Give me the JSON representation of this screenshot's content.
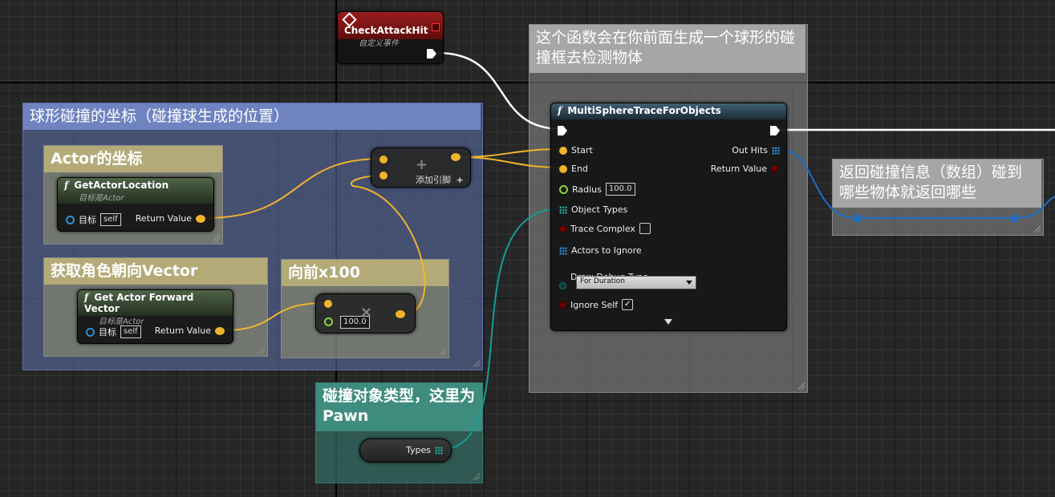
{
  "colors": {
    "exec_wire": "#ffffff",
    "vector_wire": "#f0b42c",
    "array_wire": "#1a6fc9",
    "object_wire": "#149e94"
  },
  "comments": {
    "sphere_position": "球形碰撞的坐标（碰撞球生成的位置）",
    "actor_location": "Actor的坐标",
    "forward_vector": "获取角色朝向Vector",
    "forward_x100": "向前x100",
    "trace_note": "这个函数会在你前面生成一个球形的碰撞框去检测物体",
    "return_note": "返回碰撞信息（数组）碰到哪些物体就返回哪些",
    "object_type_note": "碰撞对象类型，这里为Pawn"
  },
  "event_node": {
    "title": "CheckAttackHit",
    "subtitle": "自定义事件",
    "icon": "diamond-event-icon"
  },
  "get_location_node": {
    "title": "GetActorLocation",
    "subtitle": "目标是Actor",
    "target_label": "目标",
    "target_value": "self",
    "return_label": "Return Value"
  },
  "forward_node": {
    "title": "Get Actor Forward Vector",
    "subtitle": "目标是Actor",
    "target_label": "目标",
    "target_value": "self",
    "return_label": "Return Value"
  },
  "add_node": {
    "symbol": "+",
    "add_pin_label": "添加引脚",
    "add_pin_icon": "+"
  },
  "multiply_node": {
    "symbol": "×",
    "value": "100.0"
  },
  "trace_node": {
    "title": "MultiSphereTraceForObjects",
    "icon": "function-icon",
    "start_label": "Start",
    "end_label": "End",
    "radius_label": "Radius",
    "radius_value": "100.0",
    "object_types_label": "Object Types",
    "trace_complex_label": "Trace Complex",
    "trace_complex_checked": false,
    "actors_ignore_label": "Actors to Ignore",
    "draw_debug_label": "Draw Debug Type",
    "draw_debug_value": "For Duration",
    "ignore_self_label": "Ignore Self",
    "ignore_self_checked": true,
    "out_hits_label": "Out Hits",
    "return_label": "Return Value"
  },
  "types_node": {
    "label": "Types"
  }
}
